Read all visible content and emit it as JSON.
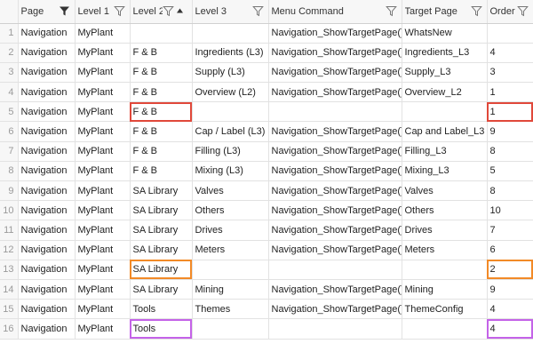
{
  "grid": {
    "columns": [
      {
        "label": "Page",
        "filter_icon": "filter-solid-icon",
        "sort": ""
      },
      {
        "label": "Level 1",
        "filter_icon": "filter-outline-icon",
        "sort": ""
      },
      {
        "label": "Level 2",
        "filter_icon": "filter-outline-icon",
        "sort": "sort-ascending-icon"
      },
      {
        "label": "Level 3",
        "filter_icon": "filter-outline-icon",
        "sort": ""
      },
      {
        "label": "Menu Command",
        "filter_icon": "filter-outline-icon",
        "sort": ""
      },
      {
        "label": "Target Page",
        "filter_icon": "filter-outline-icon",
        "sort": ""
      },
      {
        "label": "Order",
        "filter_icon": "filter-outline-icon",
        "sort": ""
      }
    ],
    "rows": [
      {
        "n": "1",
        "cells": [
          "Navigation",
          "MyPlant",
          "",
          "",
          "Navigation_ShowTargetPage()",
          "WhatsNew",
          ""
        ],
        "highlight": ""
      },
      {
        "n": "2",
        "cells": [
          "Navigation",
          "MyPlant",
          "F & B",
          "Ingredients (L3)",
          "Navigation_ShowTargetPage()",
          "Ingredients_L3",
          "4"
        ],
        "highlight": ""
      },
      {
        "n": "3",
        "cells": [
          "Navigation",
          "MyPlant",
          "F & B",
          "Supply (L3)",
          "Navigation_ShowTargetPage()",
          "Supply_L3",
          "3"
        ],
        "highlight": ""
      },
      {
        "n": "4",
        "cells": [
          "Navigation",
          "MyPlant",
          "F & B",
          "Overview (L2)",
          "Navigation_ShowTargetPage()",
          "Overview_L2",
          "1"
        ],
        "highlight": ""
      },
      {
        "n": "5",
        "cells": [
          "Navigation",
          "MyPlant",
          "F & B",
          "",
          "",
          "",
          "1"
        ],
        "highlight": "red"
      },
      {
        "n": "6",
        "cells": [
          "Navigation",
          "MyPlant",
          "F & B",
          "Cap / Label (L3)",
          "Navigation_ShowTargetPage()",
          "Cap and Label_L3",
          "9"
        ],
        "highlight": ""
      },
      {
        "n": "7",
        "cells": [
          "Navigation",
          "MyPlant",
          "F & B",
          "Filling (L3)",
          "Navigation_ShowTargetPage()",
          "Filling_L3",
          "8"
        ],
        "highlight": ""
      },
      {
        "n": "8",
        "cells": [
          "Navigation",
          "MyPlant",
          "F & B",
          "Mixing (L3)",
          "Navigation_ShowTargetPage()",
          "Mixing_L3",
          "5"
        ],
        "highlight": ""
      },
      {
        "n": "9",
        "cells": [
          "Navigation",
          "MyPlant",
          "SA Library",
          "Valves",
          "Navigation_ShowTargetPage()",
          "Valves",
          "8"
        ],
        "highlight": ""
      },
      {
        "n": "10",
        "cells": [
          "Navigation",
          "MyPlant",
          "SA Library",
          "Others",
          "Navigation_ShowTargetPage()",
          "Others",
          "10"
        ],
        "highlight": ""
      },
      {
        "n": "11",
        "cells": [
          "Navigation",
          "MyPlant",
          "SA Library",
          "Drives",
          "Navigation_ShowTargetPage()",
          "Drives",
          "7"
        ],
        "highlight": ""
      },
      {
        "n": "12",
        "cells": [
          "Navigation",
          "MyPlant",
          "SA Library",
          "Meters",
          "Navigation_ShowTargetPage()",
          "Meters",
          "6"
        ],
        "highlight": ""
      },
      {
        "n": "13",
        "cells": [
          "Navigation",
          "MyPlant",
          "SA Library",
          "",
          "",
          "",
          "2"
        ],
        "highlight": "orange"
      },
      {
        "n": "14",
        "cells": [
          "Navigation",
          "MyPlant",
          "SA Library",
          "Mining",
          "Navigation_ShowTargetPage()",
          "Mining",
          "9"
        ],
        "highlight": ""
      },
      {
        "n": "15",
        "cells": [
          "Navigation",
          "MyPlant",
          "Tools",
          "Themes",
          "Navigation_ShowTargetPage()",
          "ThemeConfig",
          "4"
        ],
        "highlight": ""
      },
      {
        "n": "16",
        "cells": [
          "Navigation",
          "MyPlant",
          "Tools",
          "",
          "",
          "",
          "4"
        ],
        "highlight": "purple"
      }
    ]
  },
  "colors": {
    "highlight_red": "#e0483a",
    "highlight_orange": "#f28a27",
    "highlight_purple": "#c463e8"
  }
}
